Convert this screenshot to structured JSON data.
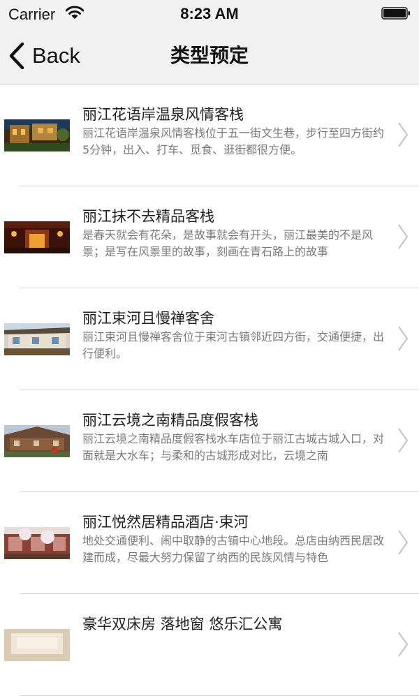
{
  "status": {
    "carrier": "Carrier",
    "time": "8:23 AM"
  },
  "nav": {
    "back_label": "Back",
    "title": "类型预定"
  },
  "items": [
    {
      "title": "丽江花语岸温泉风情客栈",
      "desc": "丽江花语岸温泉风情客栈位于五一街文生巷，步行至四方街约5分钟，出入、打车、觅食、逛街都很方便。"
    },
    {
      "title": "丽江抹不去精品客栈",
      "desc": "是春天就会有花朵，是故事就会有开头，丽江最美的不是风景；是写在风景里的故事，刻画在青石路上的故事"
    },
    {
      "title": "丽江束河且慢禅客舍",
      "desc": "丽江束河且慢禅客舍位于束河古镇邻近四方街，交通便捷，出行便利。"
    },
    {
      "title": "丽江云境之南精品度假客栈",
      "desc": "丽江云境之南精品度假客栈水车店位于丽江古城古城入口，对面就是大水车；与柔和的古城形成对比，云境之南"
    },
    {
      "title": "丽江悦然居精品酒店·束河",
      "desc": "地处交通便利、闹中取静的古镇中心地段。总店由纳西民居改建而成，尽最大努力保留了纳西的民族风情与特色"
    },
    {
      "title": "豪华双床房 落地窗 悠乐汇公寓",
      "desc": ""
    }
  ]
}
